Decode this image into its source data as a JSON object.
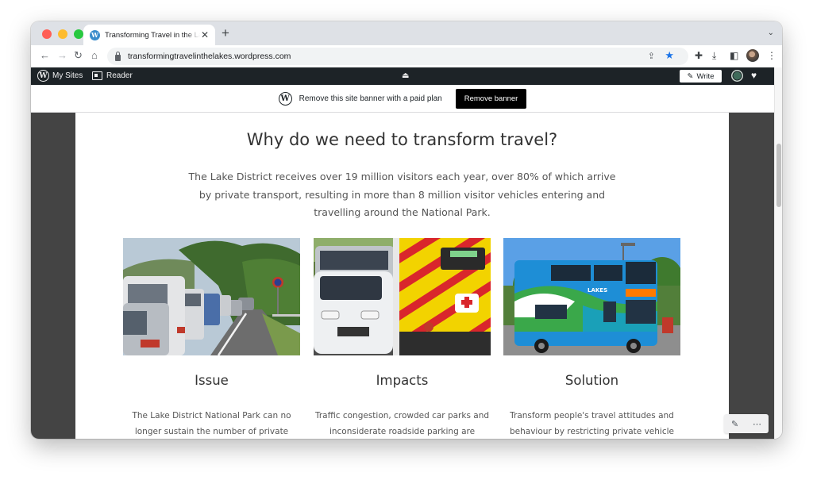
{
  "tab": {
    "title": "Transforming Travel in the Lakes",
    "favicon": "W",
    "close": "✕",
    "new_tab": "+"
  },
  "toolbar": {
    "back": "←",
    "forward": "→",
    "reload": "↻",
    "home": "⌂",
    "url": "transformingtravelinthelakes.wordpress.com",
    "share_icon": "⇪",
    "star_icon": "★",
    "extensions_icon": "✚",
    "download_icon": "⤓",
    "sidepanel_icon": "◧",
    "menu_icon": "⋮",
    "tabstrip_chevron": "⌄"
  },
  "adminbar": {
    "logo": "W",
    "my_sites": "My Sites",
    "reader": "Reader",
    "collapse_icon": "⏏",
    "write_icon": "✎",
    "write_label": "Write",
    "notif_icon": "♥"
  },
  "banner": {
    "logo": "W",
    "text": "Remove this site banner with a paid plan",
    "button": "Remove banner"
  },
  "page": {
    "heading": "Why do we need to transform travel?",
    "intro": "The Lake District receives over 19 million visitors each year, over 80% of which arrive by private transport, resulting in more than 8 million visitor vehicles entering and travelling around the National Park.",
    "columns": [
      {
        "heading": "Issue",
        "text": "The Lake District National Park can no longer sustain the number of private vehicles on its"
      },
      {
        "heading": "Impacts",
        "text": "Traffic congestion, crowded car parks and inconsiderate roadside parking are affecting"
      },
      {
        "heading": "Solution",
        "text": "Transform people's travel attitudes and behaviour by restricting private vehicle usage"
      }
    ],
    "bus_logo": "LAKES"
  },
  "float_bar": {
    "edit_icon": "✎",
    "more_icon": "⋯"
  }
}
